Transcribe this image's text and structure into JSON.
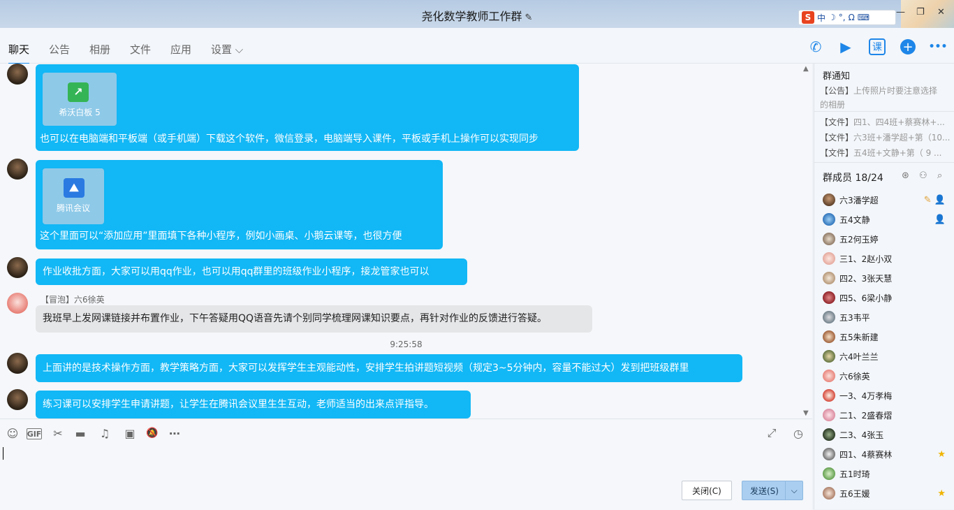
{
  "window": {
    "title": "尧化数学教师工作群",
    "edit_icon": "✎",
    "ime": {
      "logo": "S",
      "items": [
        "中",
        "☽",
        "°,",
        "Ω",
        "⌨"
      ]
    },
    "controls": [
      "—",
      "❐",
      "✕"
    ]
  },
  "tabs": [
    {
      "label": "聊天"
    },
    {
      "label": "公告"
    },
    {
      "label": "相册"
    },
    {
      "label": "文件"
    },
    {
      "label": "应用"
    },
    {
      "label": "设置 ⌵"
    }
  ],
  "toolbar_icons": {
    "phone": "✆",
    "video": "▶",
    "course": "课",
    "add": "+",
    "more": "•••"
  },
  "messages": [
    {
      "attachment": {
        "name": "希沃白板 5",
        "icon": "↗"
      },
      "text": "也可以在电脑端和平板端（或手机端）下载这个软件，微信登录，电脑端导入课件，平板或手机上操作可以实现同步"
    },
    {
      "attachment": {
        "name": "腾讯会议",
        "icon": "⛰"
      },
      "text": "这个里面可以“添加应用”里面填下各种小程序，例如小画桌、小鹅云课等，也很方便"
    },
    {
      "text": "作业收批方面，大家可以用qq作业，也可以用qq群里的班级作业小程序，接龙管家也可以"
    },
    {
      "sender": "【冒泡】六6徐英",
      "text": "我班早上发网课链接并布置作业，下午答疑用QQ语音先请个别同学梳理网课知识要点，再针对作业的反馈进行答疑。"
    },
    {
      "timestamp": "9:25:58"
    },
    {
      "text": "上面讲的是技术操作方面，教学策略方面，大家可以发挥学生主观能动性，安排学生拍讲题短视频（规定3~5分钟内，容量不能过大）发到把班级群里"
    },
    {
      "text": "练习课可以安排学生申请讲题，让学生在腾讯会议里生生互动，老师适当的出来点评指导。"
    }
  ],
  "input_tools": [
    "☺",
    "GIF",
    "✂",
    "▬",
    "♫",
    "▣",
    "🔕",
    "⋯"
  ],
  "input_right_icons": [
    "⤢",
    "◷"
  ],
  "buttons": {
    "close": "关闭(C)",
    "send": "发送(S)",
    "send_arrow": "⌵"
  },
  "group_notice": {
    "title": "群通知",
    "announcement_tag": "【公告】",
    "announcement_text": "上传照片时要注意选择",
    "announcement_text2": "的相册",
    "files": [
      {
        "tag": "【文件】",
        "name": "四1、四4班+蔡赛林+..."
      },
      {
        "tag": "【文件】",
        "name": "六3班+潘学超+第（10..."
      },
      {
        "tag": "【文件】",
        "name": "五4班+文静+第（ 9 ..."
      }
    ]
  },
  "members_header": {
    "label": "群成员 18/24",
    "icons": [
      "⊛",
      "⚇",
      "⌕"
    ]
  },
  "members": [
    {
      "name": "六3潘学超",
      "badge": "✎ 👤"
    },
    {
      "name": "五4文静",
      "badge": "👤"
    },
    {
      "name": "五2何玉婷",
      "badge": ""
    },
    {
      "name": "三1、2赵小双",
      "badge": ""
    },
    {
      "name": "四2、3张天慧",
      "badge": ""
    },
    {
      "name": "四5、6梁小静",
      "badge": ""
    },
    {
      "name": "五3韦平",
      "badge": ""
    },
    {
      "name": "五5朱新建",
      "badge": ""
    },
    {
      "name": "六4叶兰兰",
      "badge": ""
    },
    {
      "name": "六6徐英",
      "badge": ""
    },
    {
      "name": "一3、4万孝梅",
      "badge": ""
    },
    {
      "name": "二1、2盛春熠",
      "badge": ""
    },
    {
      "name": "二3、4张玉",
      "badge": ""
    },
    {
      "name": "四1、4蔡赛林",
      "badge": "★"
    },
    {
      "name": "五1时琦",
      "badge": ""
    },
    {
      "name": "五6王媛",
      "badge": "★"
    }
  ]
}
